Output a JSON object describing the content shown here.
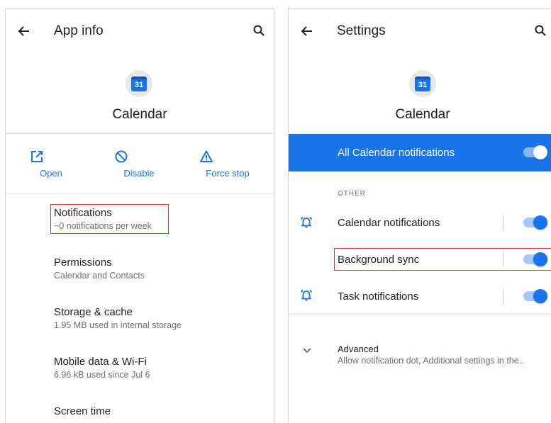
{
  "left": {
    "title": "App info",
    "app_icon_day": "31",
    "app_name": "Calendar",
    "actions": [
      {
        "label": "Open",
        "icon": "open-external-icon"
      },
      {
        "label": "Disable",
        "icon": "disable-icon"
      },
      {
        "label": "Force stop",
        "icon": "warning-icon"
      }
    ],
    "items": [
      {
        "title": "Notifications",
        "subtitle": "~0 notifications per week"
      },
      {
        "title": "Permissions",
        "subtitle": "Calendar and Contacts"
      },
      {
        "title": "Storage & cache",
        "subtitle": "1.95 MB used in internal storage"
      },
      {
        "title": "Mobile data & Wi-Fi",
        "subtitle": "6.96 kB used since Jul 6"
      },
      {
        "title": "Screen time",
        "subtitle": ""
      }
    ]
  },
  "right": {
    "title": "Settings",
    "app_icon_day": "31",
    "app_name": "Calendar",
    "master_toggle": {
      "label": "All Calendar notifications",
      "on": true
    },
    "section_label": "OTHER",
    "rows": [
      {
        "label": "Calendar notifications",
        "icon": "alarm-bell-icon",
        "on": true
      },
      {
        "label": "Background sync",
        "icon": "",
        "on": true
      },
      {
        "label": "Task notifications",
        "icon": "alarm-bell-icon",
        "on": true
      }
    ],
    "advanced": {
      "title": "Advanced",
      "subtitle": "Allow notification dot, Additional settings in the.."
    }
  },
  "colors": {
    "accent": "#1a73e8",
    "highlight": "#e3342f"
  }
}
